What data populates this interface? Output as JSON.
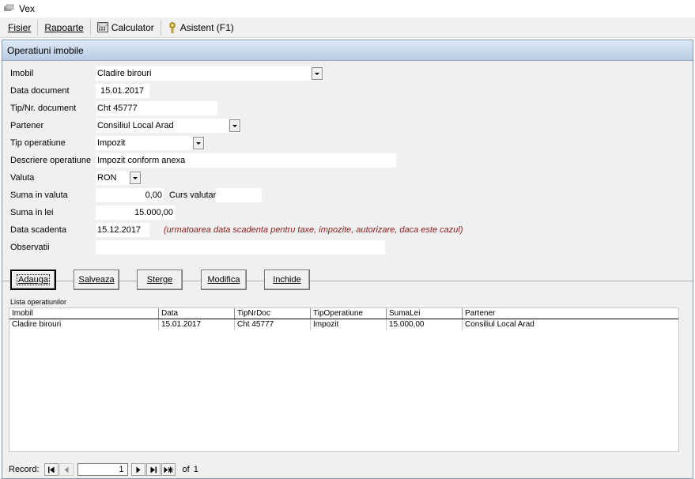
{
  "window": {
    "title": "Vex",
    "icon": "app-icon"
  },
  "menubar": {
    "items": [
      {
        "label": "Fisier"
      },
      {
        "label": "Rapoarte"
      },
      {
        "label": "Calculator",
        "icon": "calculator-icon"
      },
      {
        "label": "Asistent (F1)",
        "icon": "help-key-icon"
      }
    ]
  },
  "form": {
    "title": "Operatiuni imobile",
    "fields": {
      "imobil": {
        "label": "Imobil",
        "value": "Cladire birouri"
      },
      "data_document": {
        "label": "Data document",
        "value": "15.01.2017"
      },
      "tip_nr_document": {
        "label": "Tip/Nr. document",
        "value": "Cht 45777"
      },
      "partener": {
        "label": "Partener",
        "value": "Consiliul Local Arad"
      },
      "tip_operatiune": {
        "label": "Tip operatiune",
        "value": "Impozit"
      },
      "descriere_operatiune": {
        "label": "Descriere operatiune",
        "value": "Impozit conform anexa"
      },
      "valuta": {
        "label": "Valuta",
        "value": "RON"
      },
      "suma_in_valuta": {
        "label": "Suma in valuta",
        "value": "0,00"
      },
      "curs_valutar": {
        "label": "Curs valutar",
        "value": ""
      },
      "suma_in_lei": {
        "label": "Suma in lei",
        "value": "15.000,00"
      },
      "data_scadenta": {
        "label": "Data scadenta",
        "value": "15.12.2017",
        "hint": "(urmatoarea data scadenta pentru taxe, impozite, autorizare, daca este cazul)"
      },
      "observatii": {
        "label": "Observatii",
        "value": ""
      }
    },
    "buttons": {
      "adauga": "Adauga",
      "salveaza": "Salveaza",
      "sterge": "Sterge",
      "modifica": "Modifica",
      "inchide": "Inchide"
    },
    "list": {
      "caption": "Lista operatiunilor",
      "columns": [
        "Imobil",
        "Data",
        "TipNrDoc",
        "TipOperatiune",
        "SumaLei",
        "Partener"
      ],
      "rows": [
        [
          "Cladire birouri",
          "15.01.2017",
          "Cht 45777",
          "Impozit",
          "15.000,00",
          "Consiliul Local Arad"
        ]
      ]
    },
    "navigator": {
      "record_label": "Record:",
      "current": "1",
      "of_label": "of",
      "total": "1"
    }
  }
}
